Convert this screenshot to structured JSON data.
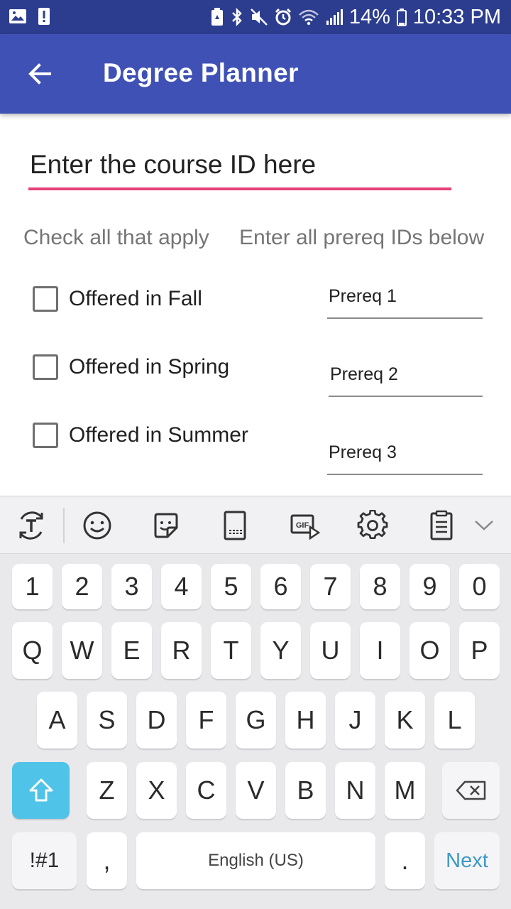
{
  "status_bar": {
    "battery_percent": "14%",
    "time": "10:33 PM",
    "icons": [
      "image-icon",
      "alert-icon",
      "battery-saver-icon",
      "bluetooth-icon",
      "mute-icon",
      "alarm-icon",
      "wifi-icon",
      "signal-icon",
      "battery-icon"
    ]
  },
  "app_bar": {
    "title": "Degree Planner"
  },
  "form": {
    "course_id_placeholder": "Enter the course ID here",
    "hint_left": "Check all that apply",
    "hint_right": "Enter all prereq IDs below",
    "checkboxes": [
      {
        "label": "Offered in Fall",
        "checked": false
      },
      {
        "label": "Offered in Spring",
        "checked": false
      },
      {
        "label": "Offered in Summer",
        "checked": false
      }
    ],
    "prereqs": [
      {
        "placeholder": "Prereq 1"
      },
      {
        "placeholder": "Prereq 2"
      },
      {
        "placeholder": "Prereq 3"
      }
    ]
  },
  "keyboard": {
    "toolbar_icons": [
      "text-mode-icon",
      "emoji-icon",
      "sticker-icon",
      "keyboard-layout-icon",
      "gif-icon",
      "settings-icon",
      "clipboard-icon",
      "chevron-down-icon"
    ],
    "gif_label": "GIF",
    "row1": [
      "1",
      "2",
      "3",
      "4",
      "5",
      "6",
      "7",
      "8",
      "9",
      "0"
    ],
    "row2": [
      "Q",
      "W",
      "E",
      "R",
      "T",
      "Y",
      "U",
      "I",
      "O",
      "P"
    ],
    "row3": [
      "A",
      "S",
      "D",
      "F",
      "G",
      "H",
      "J",
      "K",
      "L"
    ],
    "row4": [
      "Z",
      "X",
      "C",
      "V",
      "B",
      "N",
      "M"
    ],
    "symbols_label": "!#1",
    "comma_label": ",",
    "space_label": "English (US)",
    "period_label": ".",
    "action_label": "Next",
    "accent_color": "#4fc3e8",
    "action_color": "#3d98c9"
  },
  "colors": {
    "status_bar": "#2c3d8f",
    "app_bar": "#3f51b5",
    "input_underline": "#e6417a"
  }
}
